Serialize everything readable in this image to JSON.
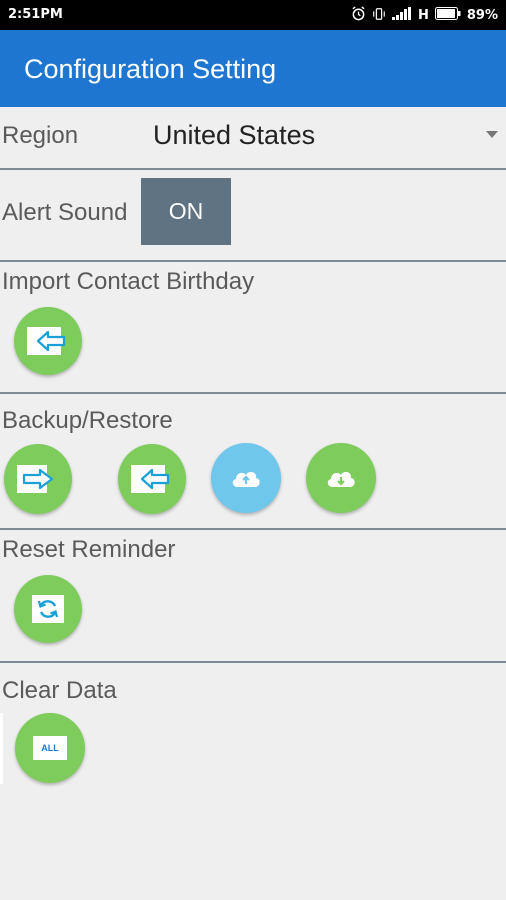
{
  "status_bar": {
    "time": "2:51PM",
    "network": "H",
    "battery": "89%"
  },
  "app_bar": {
    "title": "Configuration Setting"
  },
  "region": {
    "label": "Region",
    "value": "United States"
  },
  "alert_sound": {
    "label": "Alert Sound",
    "toggle_text": "ON"
  },
  "import_contact": {
    "label": "Import Contact Birthday"
  },
  "backup_restore": {
    "label": "Backup/Restore"
  },
  "reset_reminder": {
    "label": "Reset Reminder"
  },
  "clear_data": {
    "label": "Clear Data",
    "button_text": "ALL"
  },
  "colors": {
    "app_bar": "#1e76d0",
    "background": "#efefef",
    "green_button": "#7dcc5c",
    "blue_button": "#6fc7ec",
    "toggle_on": "#5f7382",
    "icon_arrow": "#1aa0d8"
  },
  "icons": [
    "alarm-icon",
    "vibrate-icon",
    "signal-icon",
    "battery-icon",
    "import-arrow-icon",
    "export-arrow-icon",
    "cloud-upload-icon",
    "cloud-download-icon",
    "refresh-icon",
    "dropdown-arrow-icon"
  ]
}
